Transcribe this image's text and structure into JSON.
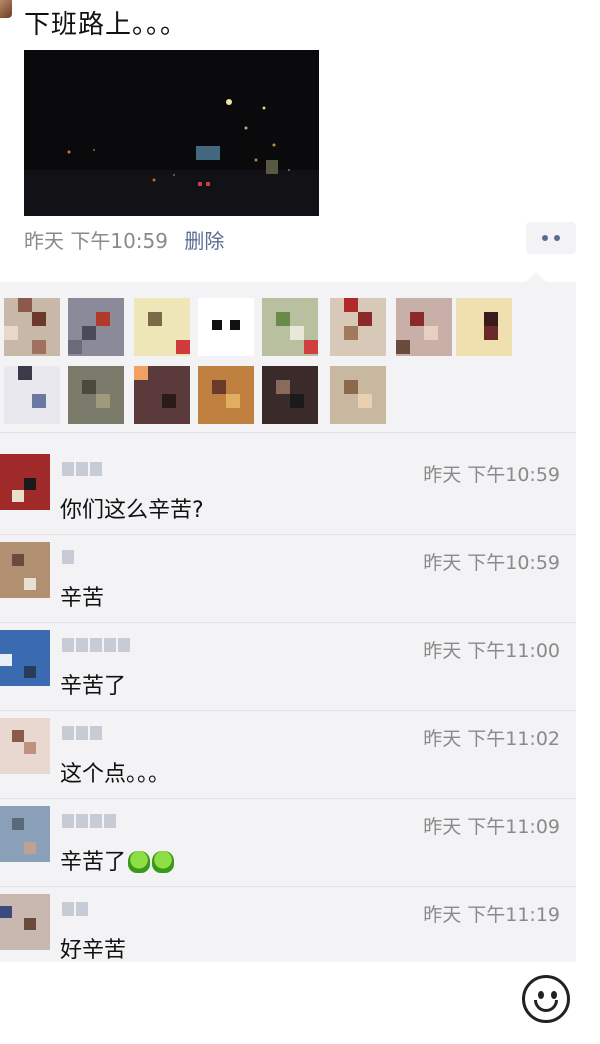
{
  "post": {
    "text": "下班路上。。。",
    "meta_time": "昨天 下午10:59",
    "delete_label": "删除"
  },
  "comments": [
    {
      "time": "昨天 下午10:59",
      "text": "你们这么辛苦?"
    },
    {
      "time": "昨天 下午10:59",
      "text": "辛苦"
    },
    {
      "time": "昨天 下午11:00",
      "text": "辛苦了"
    },
    {
      "time": "昨天 下午11:02",
      "text": "这个点。。。"
    },
    {
      "time": "昨天 下午11:09",
      "text": "辛苦了"
    },
    {
      "time": "昨天 下午11:19",
      "text": "好辛苦"
    }
  ],
  "icons": {
    "more": "more-dots-icon",
    "emoji": "smiley-face-icon",
    "inline_emoji": "green-frog-emoji-icon"
  },
  "colors": {
    "link": "#5b6b93",
    "panel_bg": "#f3f3f5",
    "time_gray": "#8a8a8a"
  }
}
